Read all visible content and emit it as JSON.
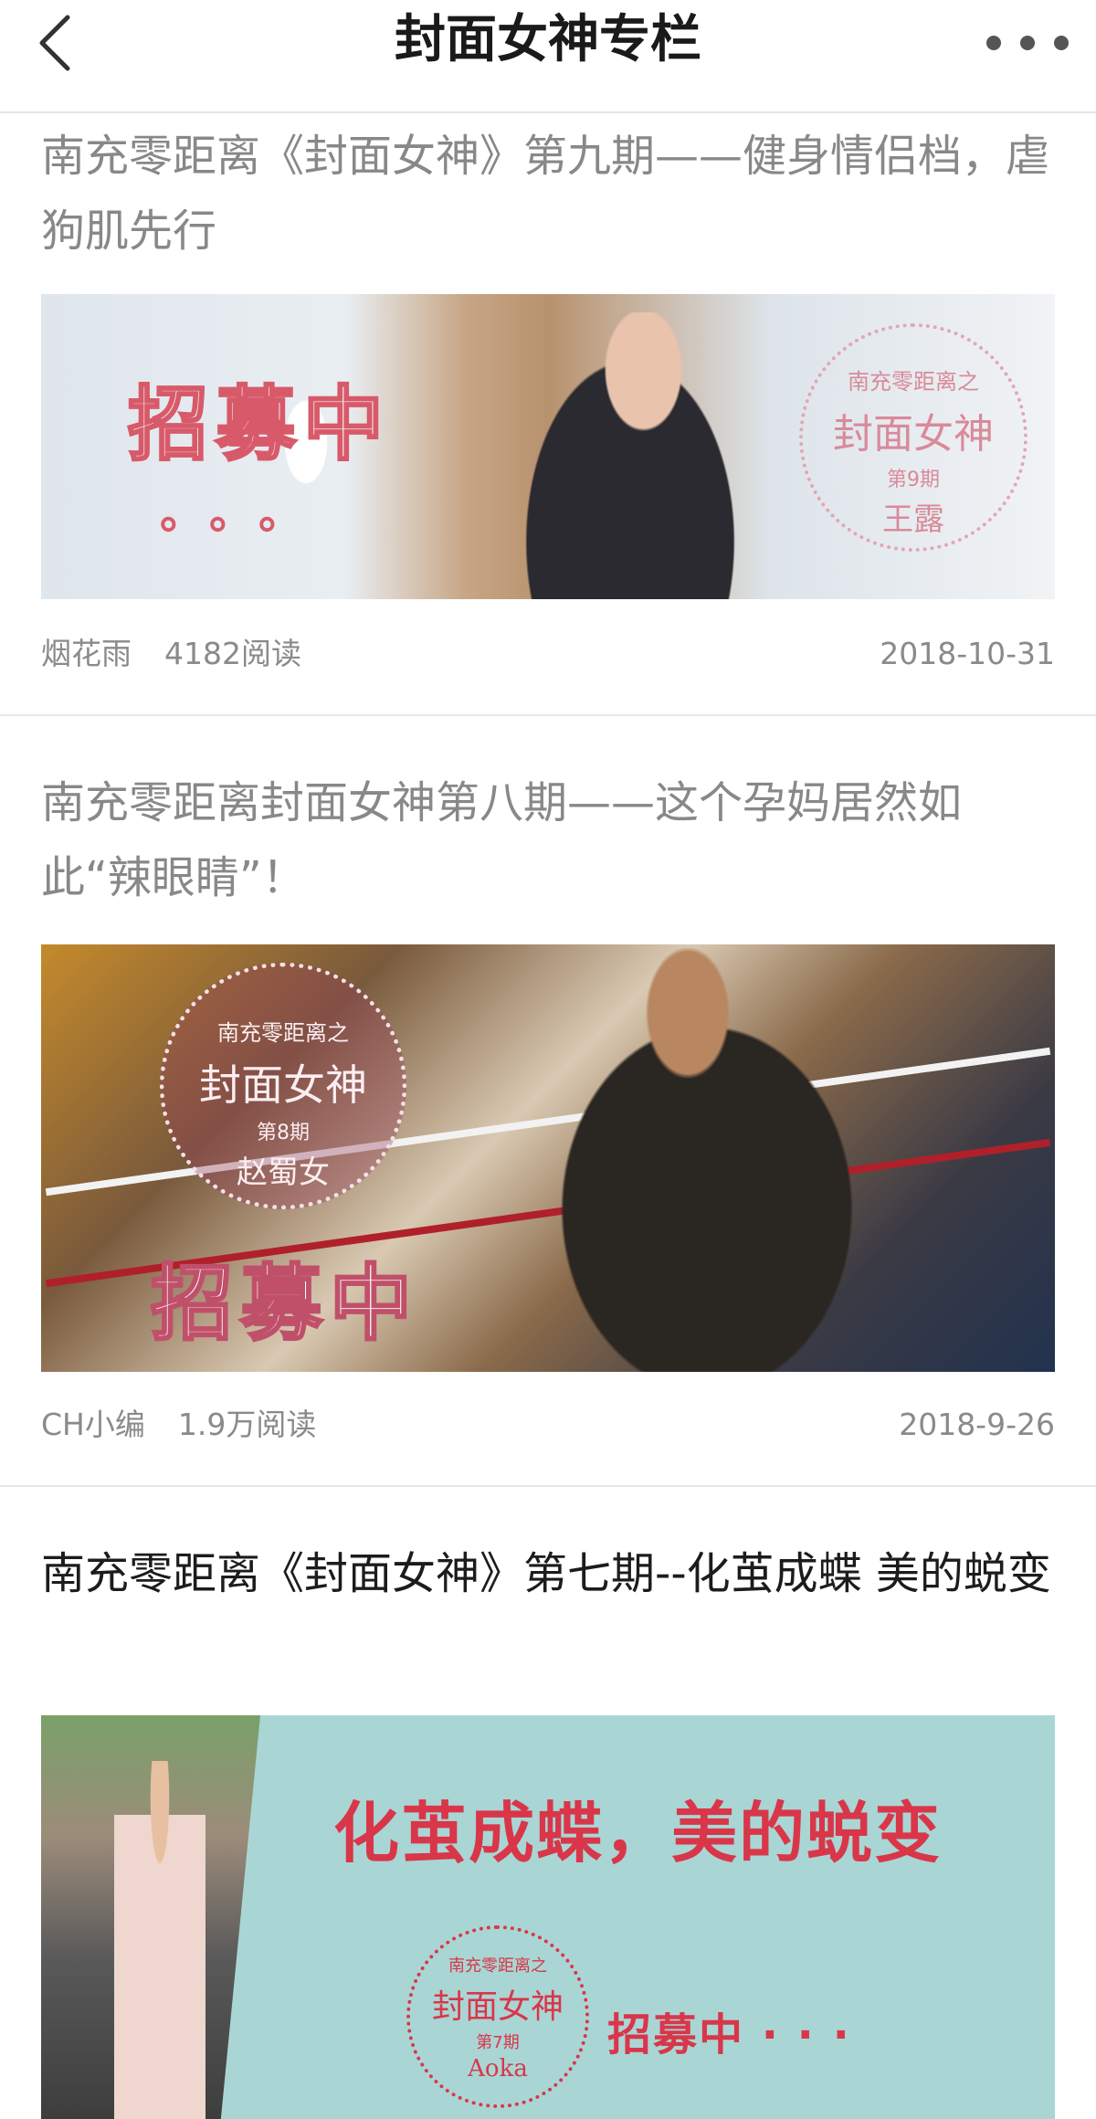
{
  "nav": {
    "title": "封面女神专栏",
    "back_icon": "chevron-left-icon",
    "more_icon": "ellipsis-icon"
  },
  "articles": [
    {
      "title": "南充零距离《封面女神》第九期——健身情侣档，虐狗肌先行",
      "author": "烟花雨",
      "reads": "4182阅读",
      "date": "2018-10-31",
      "read": true,
      "banner": {
        "headline": "招募中",
        "dots": "。。。",
        "seal_top": "南充零距离之",
        "seal_main": "封面女神",
        "seal_issue": "第9期",
        "seal_name": "王露"
      }
    },
    {
      "title": "南充零距离封面女神第八期——这个孕妈居然如此“辣眼睛”！",
      "author": "CH小编",
      "reads": "1.9万阅读",
      "date": "2018-9-26",
      "read": true,
      "banner": {
        "headline": "招募中",
        "seal_top": "南充零距离之",
        "seal_main": "封面女神",
        "seal_issue": "第8期",
        "seal_name": "赵蜀女"
      }
    },
    {
      "title": "南充零距离《封面女神》第七期--化茧成蝶 美的蜕变",
      "read": false,
      "banner": {
        "headline": "化茧成蝶，美的蜕变",
        "recruit": "招募中 · · ·",
        "seal_top": "南充零距离之",
        "seal_main": "封面女神",
        "seal_issue": "第7期",
        "seal_name": "Aoka"
      }
    }
  ],
  "colors": {
    "accent_red": "#d9364a",
    "pink": "#e8a0ae",
    "read_title": "#888888",
    "unread_title": "#1c1c1c",
    "meta": "#8a8a8a"
  }
}
